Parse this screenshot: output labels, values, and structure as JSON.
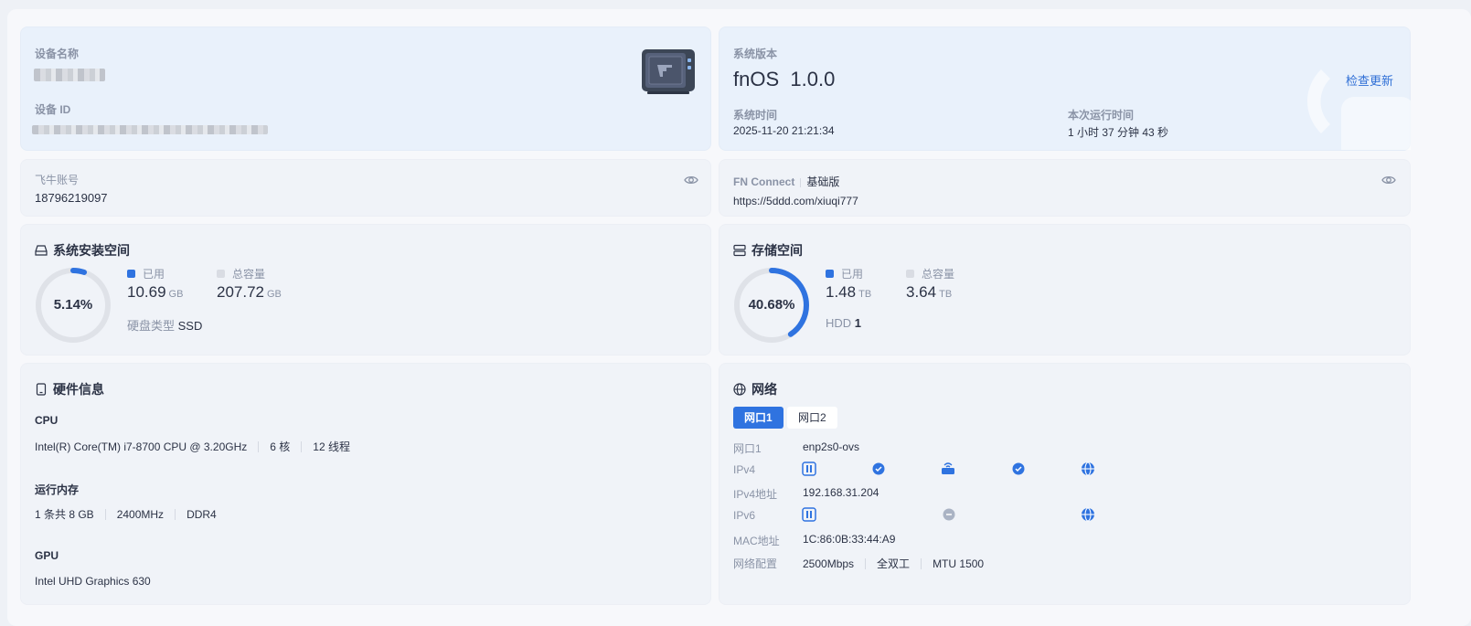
{
  "device": {
    "name_label": "设备名称",
    "id_label": "设备 ID"
  },
  "system": {
    "version_label": "系统版本",
    "os_name": "fnOS",
    "os_version": "1.0.0",
    "check_update": "检查更新",
    "time_label": "系统时间",
    "time_value": "2025-11-20 21:21:34",
    "uptime_label": "本次运行时间",
    "uptime_value": "1 小时 37 分钟 43 秒"
  },
  "account": {
    "label": "飞牛账号",
    "value": "18796219097"
  },
  "fn_connect": {
    "label": "FN Connect",
    "tier": "基础版",
    "url": "https://5ddd.com/xiuqi777"
  },
  "sys_storage": {
    "title": "系统安装空间",
    "percent": "5.14%",
    "percent_value": 5.14,
    "used_label": "已用",
    "used_value": "10.69",
    "used_unit": "GB",
    "total_label": "总容量",
    "total_value": "207.72",
    "total_unit": "GB",
    "disk_type_label": "硬盘类型",
    "disk_type_value": "SSD"
  },
  "storage": {
    "title": "存储空间",
    "percent": "40.68%",
    "percent_value": 40.68,
    "used_label": "已用",
    "used_value": "1.48",
    "used_unit": "TB",
    "total_label": "总容量",
    "total_value": "3.64",
    "total_unit": "TB",
    "disk_type_label": "HDD",
    "disk_count": "1"
  },
  "hardware": {
    "title": "硬件信息",
    "cpu_label": "CPU",
    "cpu_model": "Intel(R) Core(TM) i7-8700 CPU @ 3.20GHz",
    "cpu_cores": "6 核",
    "cpu_threads": "12 线程",
    "mem_label": "运行内存",
    "mem_sticks": "1 条共 8 GB",
    "mem_speed": "2400MHz",
    "mem_type": "DDR4",
    "gpu_label": "GPU",
    "gpu_model": "Intel UHD Graphics 630"
  },
  "network": {
    "title": "网络",
    "tabs": [
      "网口1",
      "网口2"
    ],
    "port_label": "网口1",
    "port_value": "enp2s0-ovs",
    "ipv4_label": "IPv4",
    "ipv4_addr_label": "IPv4地址",
    "ipv4_addr_value": "192.168.31.204",
    "ipv6_label": "IPv6",
    "mac_label": "MAC地址",
    "mac_value": "1C:86:0B:33:44:A9",
    "config_label": "网络配置",
    "config_speed": "2500Mbps",
    "config_duplex": "全双工",
    "config_mtu": "MTU 1500"
  },
  "colors": {
    "accent": "#2f73e0",
    "ring_track": "#dfe2e8",
    "muted": "#8a93a6",
    "legend_used": "#2f73e0",
    "legend_total": "#d9dce3"
  }
}
